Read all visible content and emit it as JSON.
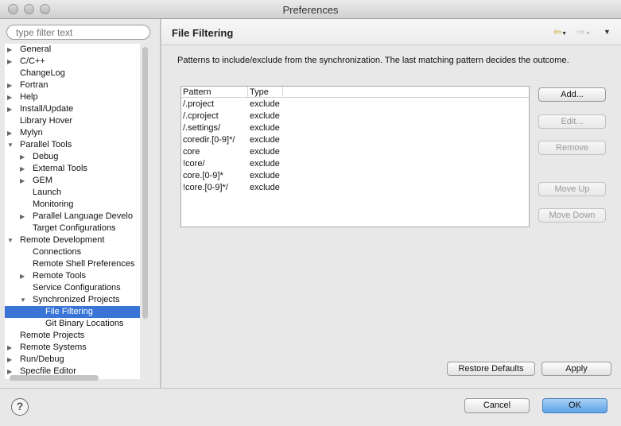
{
  "window": {
    "title": "Preferences"
  },
  "left": {
    "filter_placeholder": "type filter text",
    "tree": [
      {
        "label": "General",
        "level": 0,
        "expander": "collapsed"
      },
      {
        "label": "C/C++",
        "level": 0,
        "expander": "collapsed"
      },
      {
        "label": "ChangeLog",
        "level": 0,
        "expander": "none"
      },
      {
        "label": "Fortran",
        "level": 0,
        "expander": "collapsed"
      },
      {
        "label": "Help",
        "level": 0,
        "expander": "collapsed"
      },
      {
        "label": "Install/Update",
        "level": 0,
        "expander": "collapsed"
      },
      {
        "label": "Library Hover",
        "level": 0,
        "expander": "none"
      },
      {
        "label": "Mylyn",
        "level": 0,
        "expander": "collapsed"
      },
      {
        "label": "Parallel Tools",
        "level": 0,
        "expander": "expanded"
      },
      {
        "label": "Debug",
        "level": 1,
        "expander": "collapsed"
      },
      {
        "label": "External Tools",
        "level": 1,
        "expander": "collapsed"
      },
      {
        "label": "GEM",
        "level": 1,
        "expander": "collapsed"
      },
      {
        "label": "Launch",
        "level": 1,
        "expander": "none"
      },
      {
        "label": "Monitoring",
        "level": 1,
        "expander": "none"
      },
      {
        "label": "Parallel Language Develo",
        "level": 1,
        "expander": "collapsed"
      },
      {
        "label": "Target Configurations",
        "level": 1,
        "expander": "none"
      },
      {
        "label": "Remote Development",
        "level": 0,
        "expander": "expanded"
      },
      {
        "label": "Connections",
        "level": 1,
        "expander": "none"
      },
      {
        "label": "Remote Shell Preferences",
        "level": 1,
        "expander": "none"
      },
      {
        "label": "Remote Tools",
        "level": 1,
        "expander": "collapsed"
      },
      {
        "label": "Service Configurations",
        "level": 1,
        "expander": "none"
      },
      {
        "label": "Synchronized Projects",
        "level": 1,
        "expander": "expanded"
      },
      {
        "label": "File Filtering",
        "level": 2,
        "expander": "none",
        "selected": true
      },
      {
        "label": "Git Binary Locations",
        "level": 2,
        "expander": "none"
      },
      {
        "label": "Remote Projects",
        "level": 0,
        "expander": "none"
      },
      {
        "label": "Remote Systems",
        "level": 0,
        "expander": "collapsed"
      },
      {
        "label": "Run/Debug",
        "level": 0,
        "expander": "collapsed"
      },
      {
        "label": "Specfile Editor",
        "level": 0,
        "expander": "collapsed"
      }
    ]
  },
  "page": {
    "title": "File Filtering",
    "description": "Patterns to include/exclude from the synchronization. The last matching pattern decides the outcome.",
    "table": {
      "columns": [
        "Pattern",
        "Type"
      ],
      "rows": [
        [
          "/.project",
          "exclude"
        ],
        [
          "/.cproject",
          "exclude"
        ],
        [
          "/.settings/",
          "exclude"
        ],
        [
          "coredir.[0-9]*/",
          "exclude"
        ],
        [
          "core",
          "exclude"
        ],
        [
          "!core/",
          "exclude"
        ],
        [
          "core.[0-9]*",
          "exclude"
        ],
        [
          "!core.[0-9]*/",
          "exclude"
        ]
      ]
    },
    "buttons": {
      "add": "Add...",
      "edit": "Edit...",
      "remove": "Remove",
      "move_up": "Move Up",
      "move_down": "Move Down"
    },
    "restore_defaults": "Restore Defaults",
    "apply": "Apply"
  },
  "footer": {
    "help_glyph": "?",
    "cancel": "Cancel",
    "ok": "OK"
  },
  "icons": {
    "back": "back-arrow-icon",
    "forward": "forward-arrow-icon",
    "menu": "view-menu-icon"
  },
  "colors": {
    "selection": "#3875d7",
    "ok_button": "#5ea3e6"
  }
}
